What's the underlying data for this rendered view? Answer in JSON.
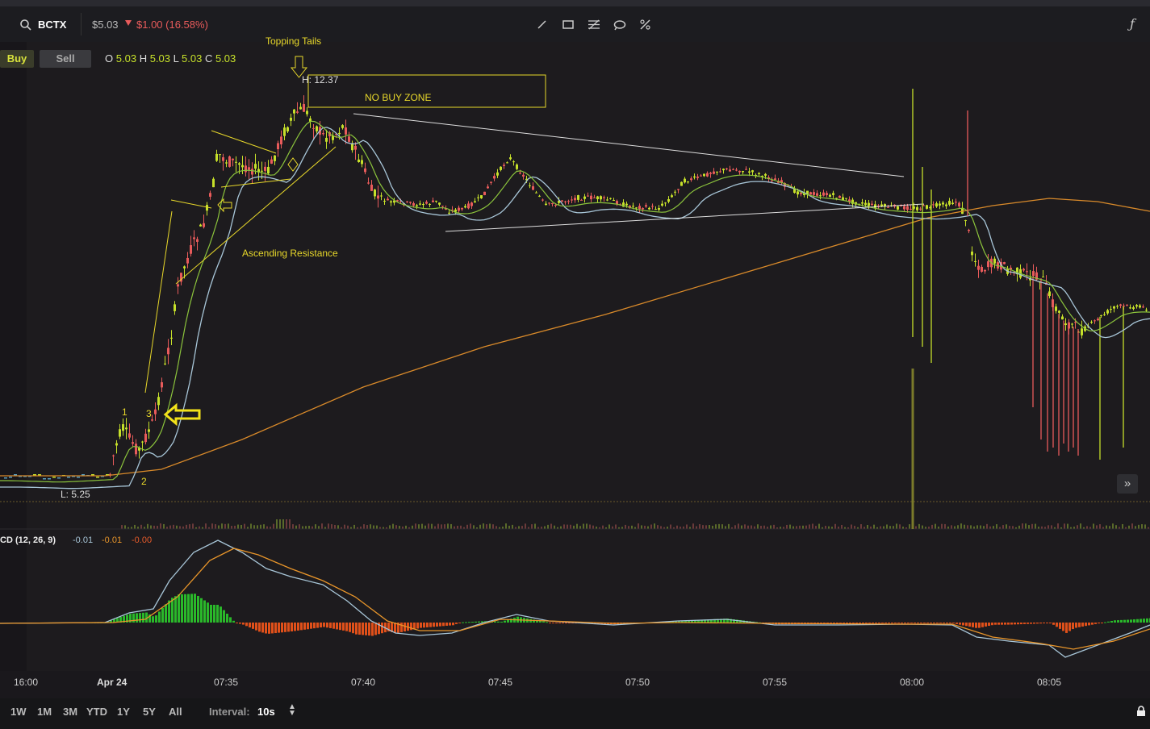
{
  "header": {
    "ticker": "BCTX",
    "price": "$5.03",
    "change": "$1.00 (16.58%)",
    "colors": {
      "up": "#c6e02a",
      "down": "#e85b5b",
      "accent": "#f2e21a"
    },
    "tools": [
      "line-tool-icon",
      "rectangle-tool-icon",
      "fib-tool-icon",
      "ellipse-tool-icon",
      "erase-tool-icon",
      "formula-icon"
    ]
  },
  "trade": {
    "buy_label": "Buy",
    "sell_label": "Sell"
  },
  "ohlc": {
    "o_label": "O",
    "o": "5.03",
    "h_label": "H",
    "h": "5.03",
    "l_label": "L",
    "l": "5.03",
    "c_label": "C",
    "c": "5.03"
  },
  "annotations": {
    "topping_tails": "Topping Tails",
    "high": "H: 12.37",
    "no_buy_zone": "NO BUY ZONE",
    "ascending_resistance": "Ascending Resistance",
    "low": "L: 5.25",
    "num1": "1",
    "num2": "2",
    "num3": "3"
  },
  "macd": {
    "label": "CD (12, 26, 9)",
    "v1": "-0.01",
    "v2": "-0.01",
    "v3": "-0.00"
  },
  "time_axis": [
    "16:00",
    "Apr 24",
    "07:35",
    "07:40",
    "07:45",
    "07:50",
    "07:55",
    "08:00",
    "08:05"
  ],
  "ranges": [
    "1W",
    "1M",
    "3M",
    "YTD",
    "1Y",
    "5Y",
    "All"
  ],
  "interval": {
    "label": "Interval:",
    "value": "10s"
  },
  "chart_data": {
    "type": "line",
    "x": [
      "Apr 24",
      "07:35",
      "07:40",
      "07:45",
      "07:50",
      "07:55",
      "08:00",
      "08:05"
    ],
    "series": [
      {
        "values": [
          5.8,
          11.0,
          11.3,
          10.3,
          10.2,
          10.2,
          10.0,
          8.2
        ]
      }
    ]
  }
}
